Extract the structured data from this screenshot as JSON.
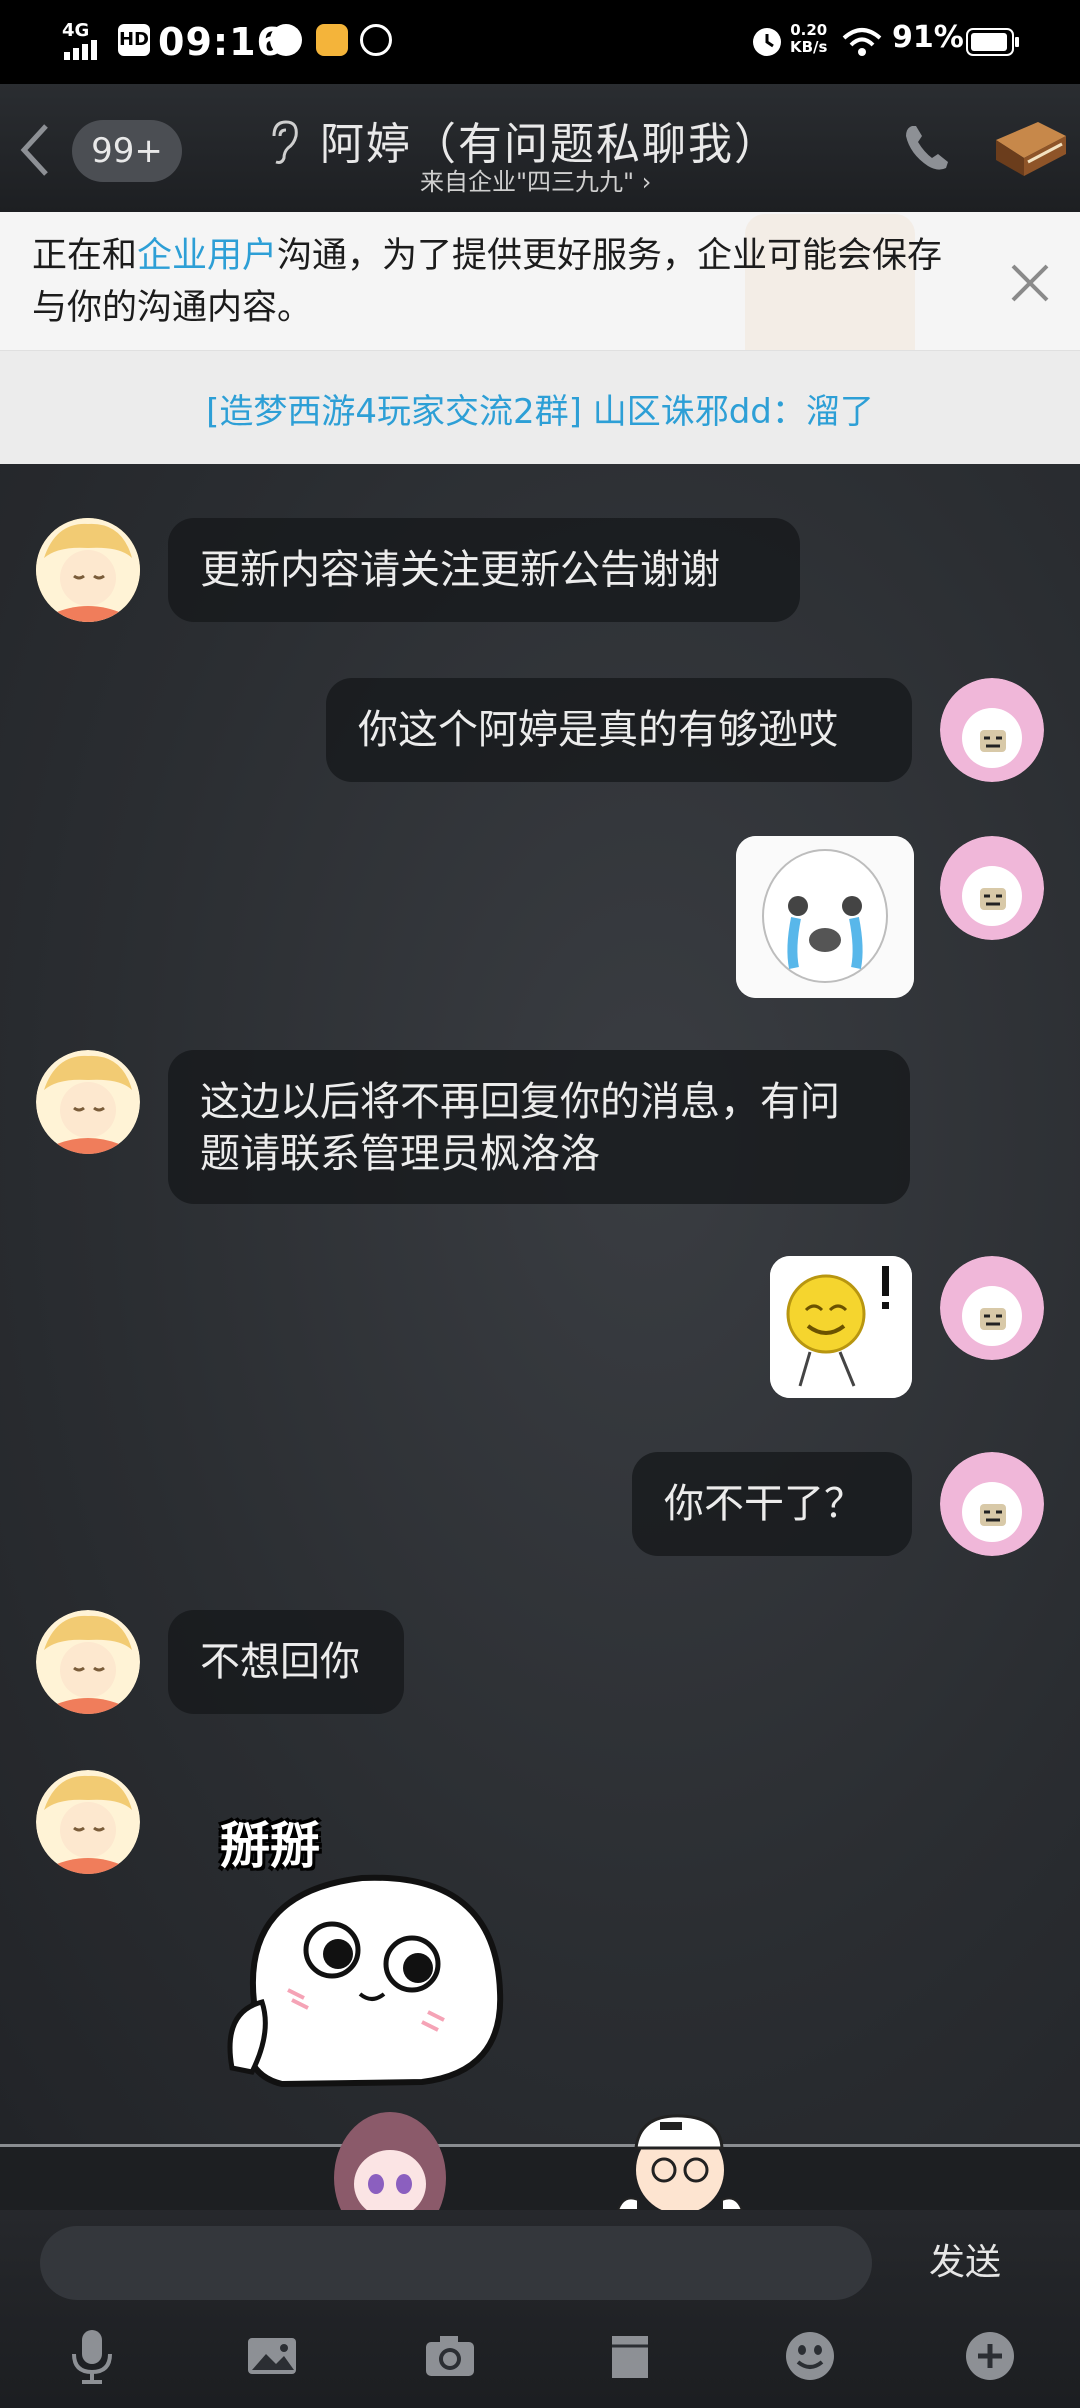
{
  "status_bar": {
    "network": "4G",
    "hd": "HD",
    "time": "09:16",
    "speed_value": "0.20",
    "speed_unit": "KB/s",
    "battery": "91%"
  },
  "header": {
    "unread_badge": "99+",
    "title": "阿婷（有问题私聊我）",
    "subtitle": "来自企业\"四三九九\" ›"
  },
  "notice": {
    "prefix": "正在和",
    "link": "企业用户",
    "suffix": "沟通，为了提供更好服务，企业可能会保存与你的沟通内容。"
  },
  "group_message": "[造梦西游4玩家交流2群] 山区诛邪dd：溜了",
  "messages": [
    {
      "side": "left",
      "type": "text",
      "text": "更新内容请关注更新公告谢谢"
    },
    {
      "side": "right",
      "type": "text",
      "text": "你这个阿婷是真的有够逊哎"
    },
    {
      "side": "right",
      "type": "sticker",
      "sticker": "crying-panda-sticker"
    },
    {
      "side": "left",
      "type": "text",
      "text": "这边以后将不再回复你的消息，有问题请联系管理员枫洛洛"
    },
    {
      "side": "right",
      "type": "sticker",
      "sticker": "yellow-face-sticker"
    },
    {
      "side": "right",
      "type": "text",
      "text": "你不干了？"
    },
    {
      "side": "left",
      "type": "text",
      "text": "不想回你"
    },
    {
      "side": "left",
      "type": "sticker",
      "sticker": "bye-bye-sticker",
      "caption": "掰掰"
    }
  ],
  "input": {
    "placeholder": "",
    "send_label": "发送"
  },
  "toolbar": [
    "mic-icon",
    "image-icon",
    "camera-icon",
    "file-icon",
    "emoji-icon",
    "plus-icon"
  ],
  "colors": {
    "link": "#2d9fd6",
    "bubble": "#17191c",
    "badge": "#4b4e53",
    "avatar_pink": "#f0b7d9"
  }
}
